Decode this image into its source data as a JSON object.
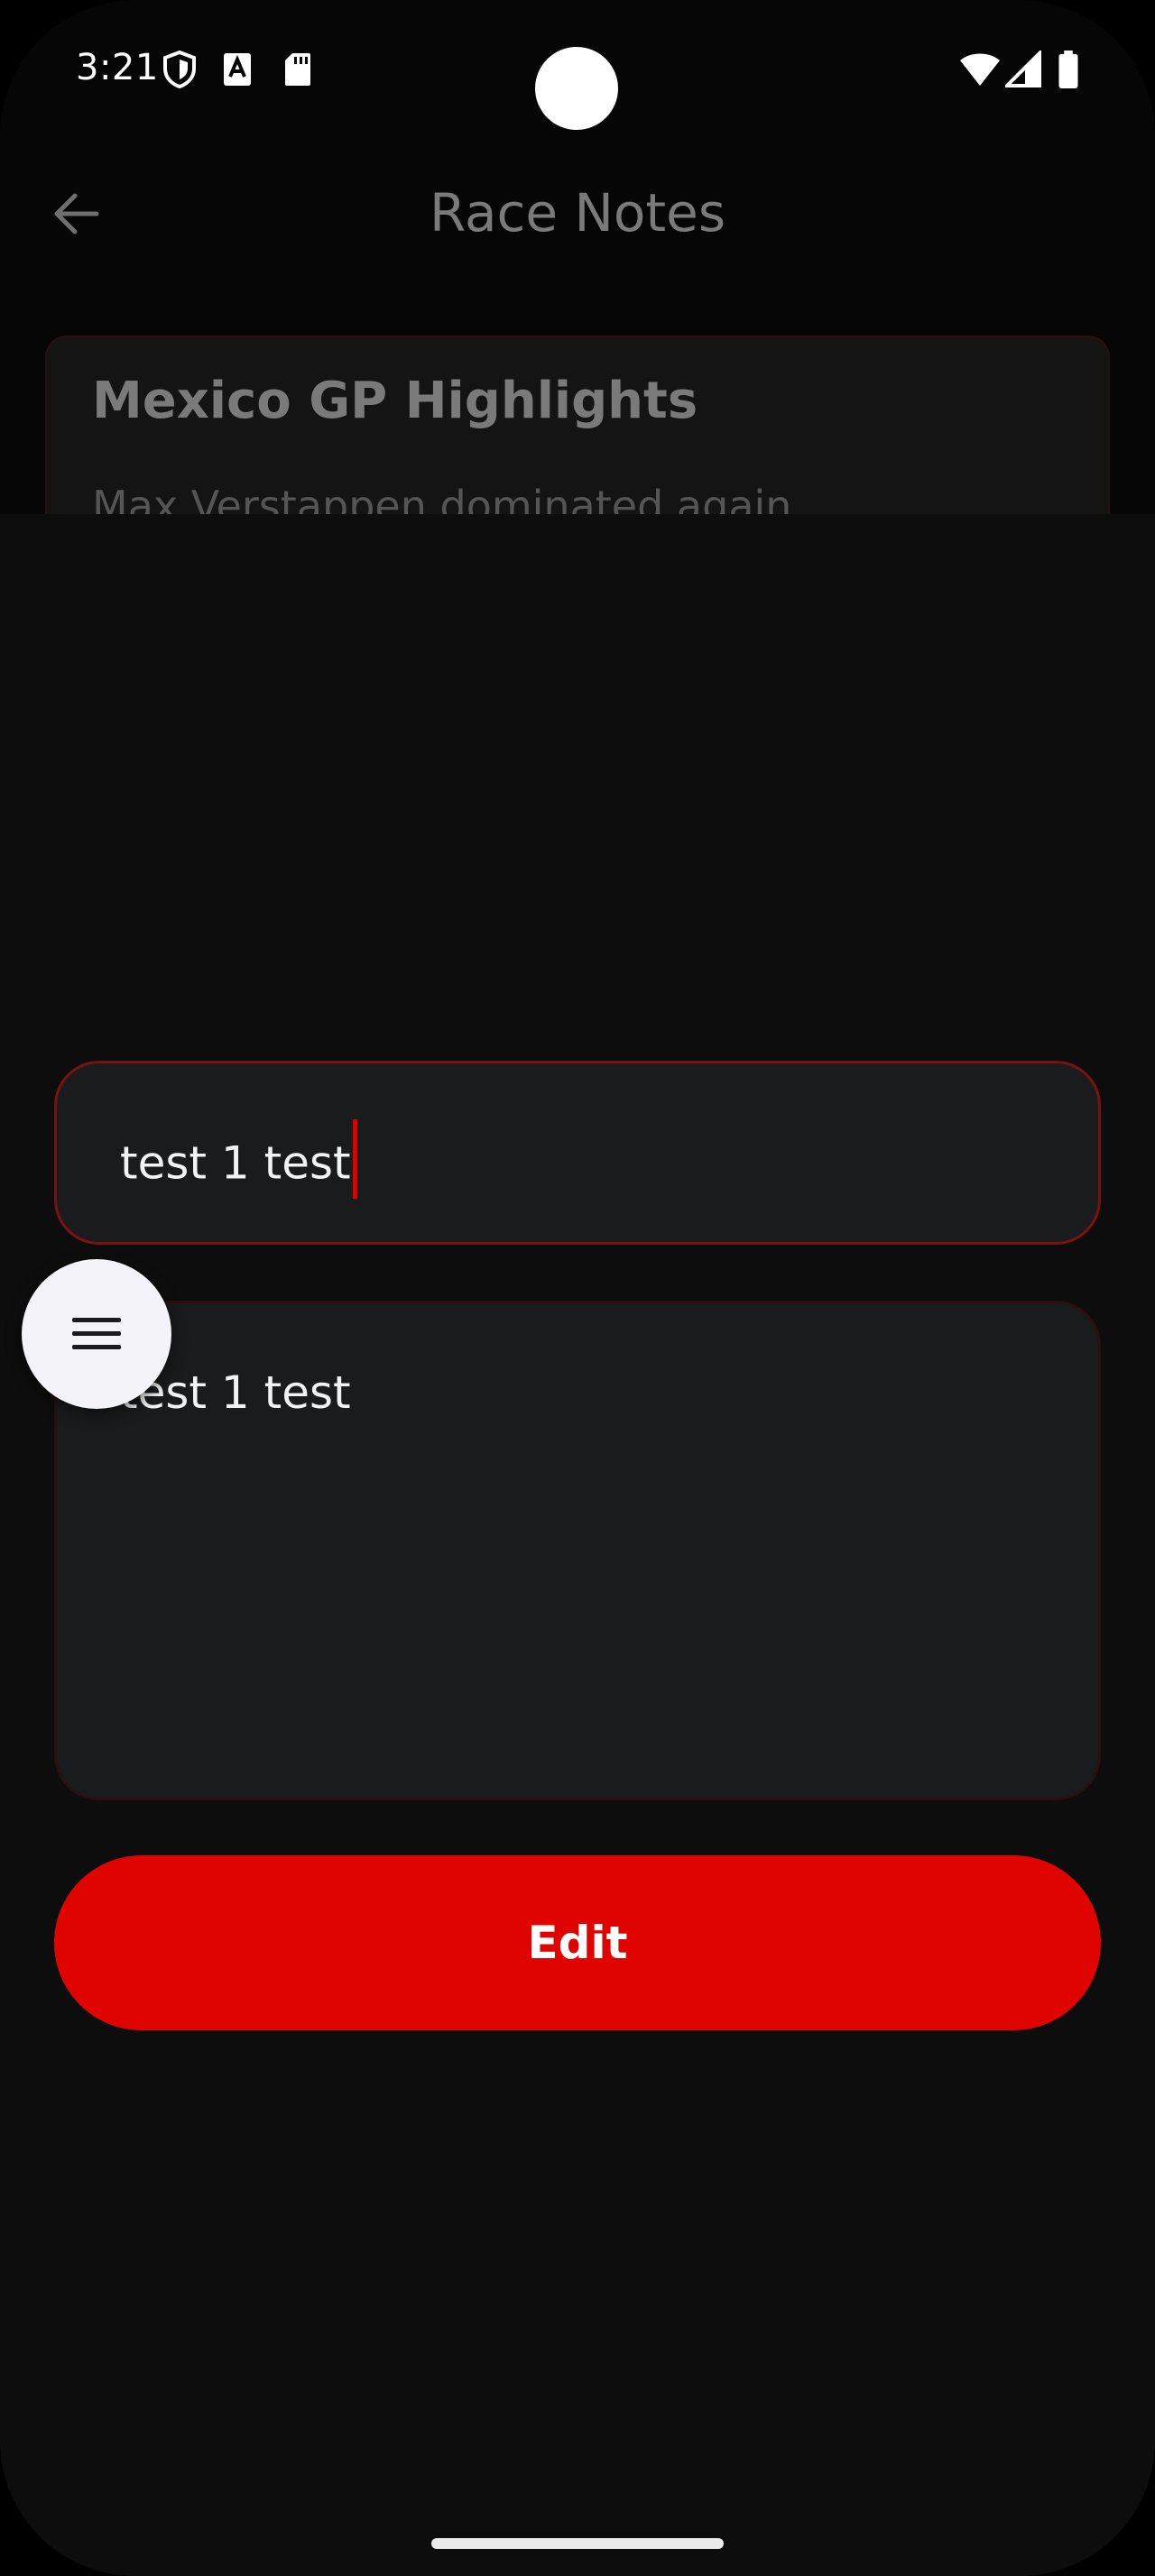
{
  "status_bar": {
    "time": "3:21",
    "left_icons": [
      "shield-icon",
      "font-a-icon",
      "sd-card-icon"
    ],
    "right_icons": [
      "wifi-icon",
      "cellular-signal-icon",
      "battery-icon"
    ]
  },
  "app_bar": {
    "title": "Race Notes",
    "back_icon": "arrow-left-icon"
  },
  "note_card": {
    "title": "Mexico GP Highlights",
    "body_preview": "Max Verstappen dominated again"
  },
  "edit_sheet": {
    "title_value": "test 1 test",
    "content_value": "test 1 test",
    "edit_button_label": "Edit"
  },
  "fab": {
    "icon": "menu-icon"
  },
  "colors": {
    "accent": "#e00400",
    "field_bg": "#1a1b1d",
    "sheet_bg": "#0d0d0d",
    "focused_border": "#7a1212"
  }
}
